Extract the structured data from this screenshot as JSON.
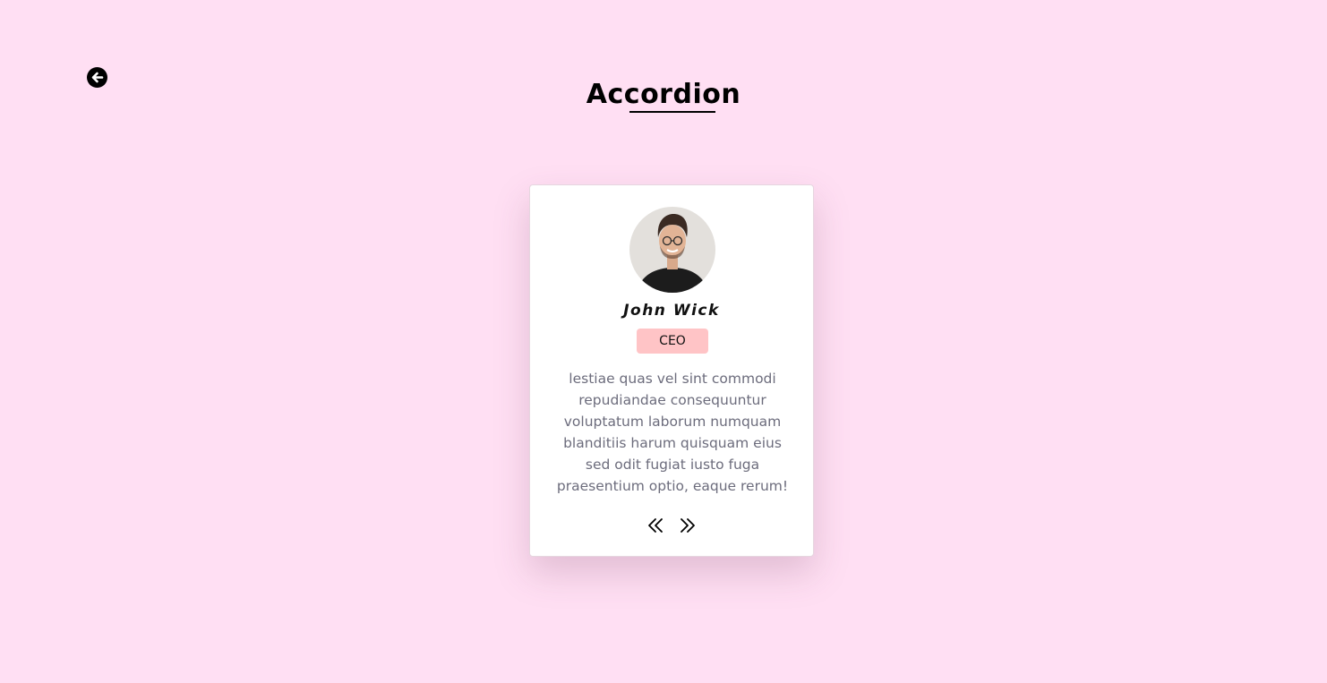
{
  "page": {
    "title": "Accordion",
    "background_color": "#ffdff3"
  },
  "back_button": {
    "icon": "arrow-left-circle-icon"
  },
  "card": {
    "name": "John Wick",
    "role": "CEO",
    "role_badge_color": "#ffc4c6",
    "quote": "lestiae quas vel sint commodi repudiandae consequuntur voluptatum laborum numquam blanditiis harum quisquam eius sed odit fugiat iusto fuga praesentium optio, eaque rerum!",
    "avatar_icon": "avatar-photo",
    "prev_icon": "double-chevron-left-icon",
    "next_icon": "double-chevron-right-icon"
  }
}
